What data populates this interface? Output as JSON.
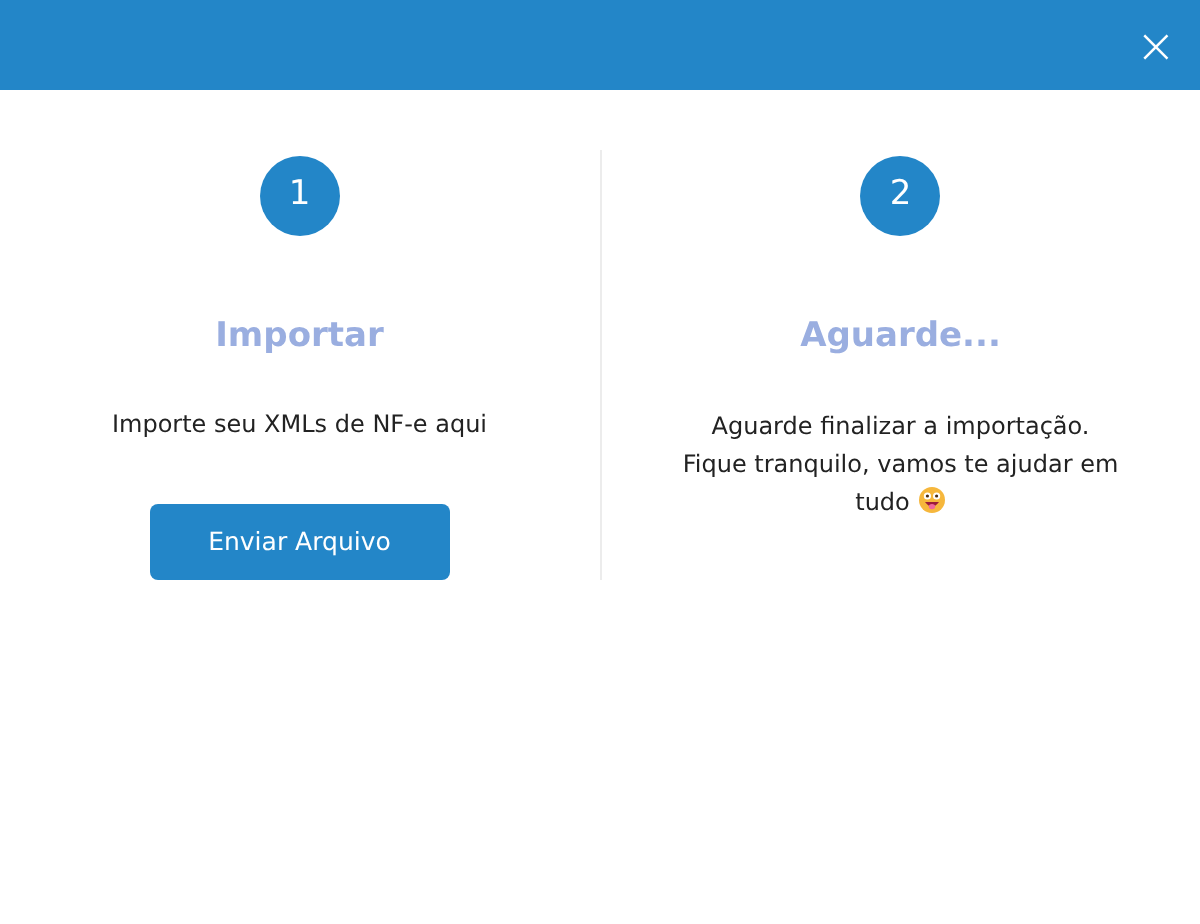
{
  "header": {
    "close": "×"
  },
  "steps": [
    {
      "number": "1",
      "title": "Importar",
      "lines": [
        "Importe seu XMLs de NF-e aqui"
      ],
      "button": "Enviar Arquivo",
      "emoji": false
    },
    {
      "number": "2",
      "title": "Aguarde...",
      "lines": [
        "Aguarde finalizar a importação.",
        "Fique tranquilo, vamos te ajudar em tudo"
      ],
      "emoji": true
    }
  ]
}
